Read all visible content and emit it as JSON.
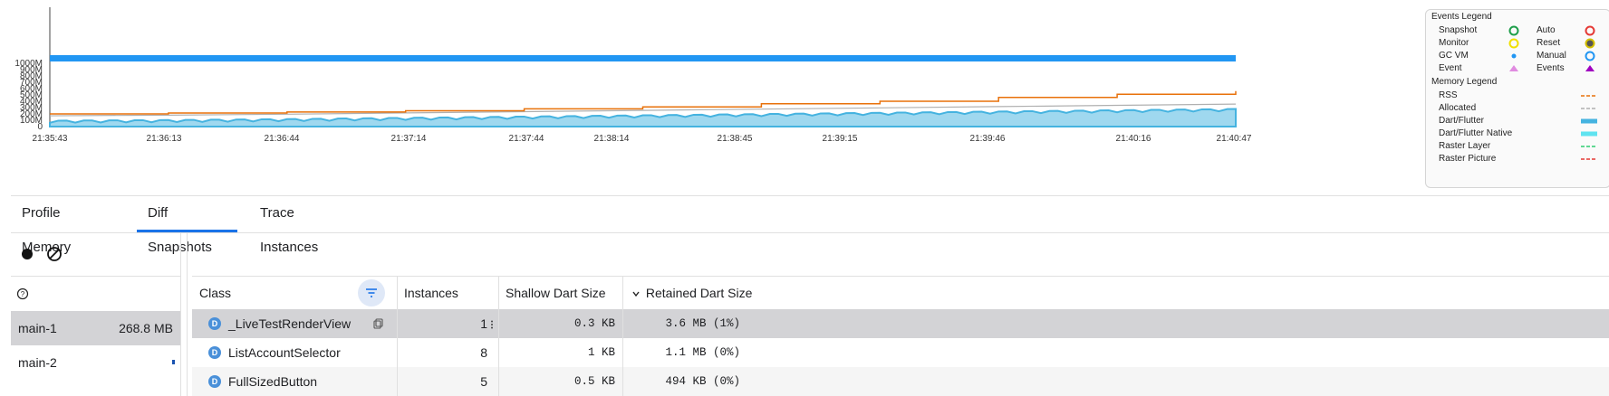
{
  "chart_data": {
    "type": "area",
    "title": "",
    "y_ticks": [
      "1000M",
      "900M",
      "800M",
      "700M",
      "600M",
      "500M",
      "400M",
      "300M",
      "200M",
      "100M",
      "0"
    ],
    "x_ticks": [
      "21:35:43",
      "21:36:13",
      "21:36:44",
      "21:37:14",
      "21:37:44",
      "21:38:14",
      "21:38:45",
      "21:39:15",
      "21:39:46",
      "21:40:16",
      "21:40:47"
    ],
    "ylim": [
      0,
      1000
    ],
    "series": [
      {
        "name": "RSS",
        "color": "#e8710a",
        "x_frac": [
          0,
          0.1,
          0.2,
          0.3,
          0.4,
          0.5,
          0.6,
          0.7,
          0.8,
          0.9,
          1.0
        ],
        "values": [
          200,
          215,
          230,
          250,
          280,
          310,
          360,
          400,
          460,
          510,
          560
        ]
      },
      {
        "name": "Allocated",
        "color": "#b0b0b0",
        "x_frac": [
          0,
          0.1,
          0.2,
          0.3,
          0.4,
          0.5,
          0.6,
          0.7,
          0.8,
          0.9,
          1.0
        ],
        "values": [
          85,
          95,
          110,
          130,
          150,
          170,
          190,
          210,
          230,
          250,
          270
        ]
      },
      {
        "name": "Dart/Flutter",
        "color": "#45b3e0",
        "x_frac": [
          0,
          0.1,
          0.2,
          0.3,
          0.4,
          0.5,
          0.6,
          0.7,
          0.8,
          0.9,
          1.0
        ],
        "values": [
          85,
          95,
          110,
          130,
          150,
          170,
          190,
          210,
          230,
          250,
          270
        ]
      }
    ],
    "gc_bar_color": "#2196f3"
  },
  "legend": {
    "events_title": "Events Legend",
    "memory_title": "Memory Legend",
    "events_left": [
      {
        "label": "Snapshot",
        "icon": "circle-ring",
        "color": "#1e9e4a"
      },
      {
        "label": "Monitor",
        "icon": "circle-ring",
        "color": "#f0e000"
      },
      {
        "label": "GC VM",
        "icon": "dot",
        "color": "#2196f3"
      },
      {
        "label": "Event",
        "icon": "triangle",
        "color": "#e08be0"
      }
    ],
    "events_right": [
      {
        "label": "Auto",
        "icon": "circle-ring",
        "color": "#e53935"
      },
      {
        "label": "Reset",
        "icon": "circle-ring-filled",
        "color": "#d4c000"
      },
      {
        "label": "Manual",
        "icon": "circle-ring",
        "color": "#2196f3"
      },
      {
        "label": "Events",
        "icon": "triangle",
        "color": "#a000c0"
      }
    ],
    "memory": [
      {
        "label": "RSS",
        "style": "dashed",
        "color": "#e8710a"
      },
      {
        "label": "Allocated",
        "style": "dashed",
        "color": "#b0b0b0"
      },
      {
        "label": "Dart/Flutter",
        "style": "solid-thick",
        "color": "#45b3e0"
      },
      {
        "label": "Dart/Flutter Native",
        "style": "solid-thick",
        "color": "#5fe3f0"
      },
      {
        "label": "Raster Layer",
        "style": "dashed",
        "color": "#2ecc71"
      },
      {
        "label": "Raster Picture",
        "style": "dashed",
        "color": "#e53935"
      }
    ]
  },
  "tabs": [
    {
      "label": "Profile Memory",
      "active": false
    },
    {
      "label": "Diff Snapshots",
      "active": true
    },
    {
      "label": "Trace Instances",
      "active": false
    }
  ],
  "toolbar": {
    "record_icon": "record-icon",
    "clear_icon": "clear-icon",
    "help_icon": "help-icon"
  },
  "snapshots": [
    {
      "name": "main-1",
      "size": "268.8 MB",
      "selected": true
    },
    {
      "name": "main-2",
      "size": "",
      "selected": false
    }
  ],
  "table": {
    "headers": {
      "class": "Class",
      "instances": "Instances",
      "shallow": "Shallow Dart Size",
      "retained": "Retained Dart Size"
    },
    "rows": [
      {
        "badge": "D",
        "class": "_LiveTestRenderView",
        "instances": "1",
        "shallow": "0.3 KB",
        "retained": "3.6 MB (1%)"
      },
      {
        "badge": "D",
        "class": "ListAccountSelector",
        "instances": "8",
        "shallow": "1 KB",
        "retained": "1.1 MB (0%)"
      },
      {
        "badge": "D",
        "class": "FullSizedButton",
        "instances": "5",
        "shallow": "0.5 KB",
        "retained": "494 KB (0%)"
      }
    ]
  }
}
